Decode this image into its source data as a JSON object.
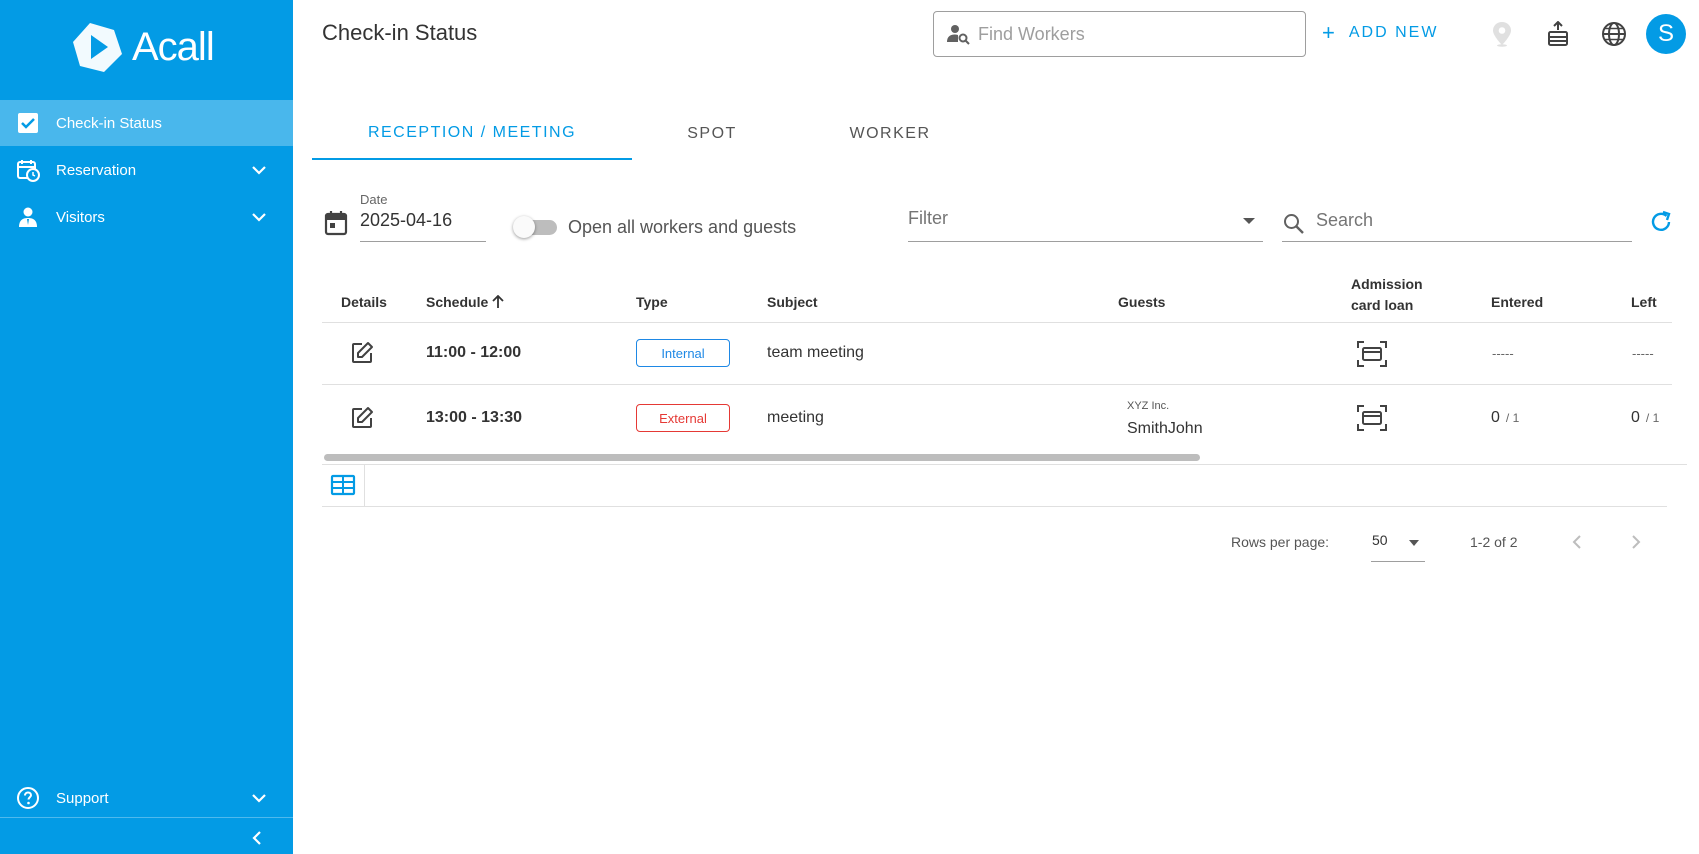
{
  "app": {
    "name": "Acall"
  },
  "sidebar": {
    "items": [
      {
        "label": "Check-in Status",
        "icon": "checkbox-icon",
        "active": true
      },
      {
        "label": "Reservation",
        "icon": "calendar-clock-icon",
        "expandable": true
      },
      {
        "label": "Visitors",
        "icon": "visitor-icon",
        "expandable": true
      }
    ],
    "support": {
      "label": "Support",
      "icon": "help-circle-icon"
    }
  },
  "header": {
    "title": "Check-in Status",
    "find_placeholder": "Find Workers",
    "add_new_label": "ADD NEW",
    "avatar_initial": "S"
  },
  "tabs": [
    {
      "label": "RECEPTION / MEETING",
      "active": true
    },
    {
      "label": "SPOT",
      "active": false
    },
    {
      "label": "WORKER",
      "active": false
    }
  ],
  "controls": {
    "date_label": "Date",
    "date_value": "2025-04-16",
    "toggle_label": "Open all workers and guests",
    "toggle_on": false,
    "filter_placeholder": "Filter",
    "search_placeholder": "Search"
  },
  "table": {
    "columns": {
      "details": "Details",
      "schedule": "Schedule",
      "type": "Type",
      "subject": "Subject",
      "guests": "Guests",
      "admission_line1": "Admission",
      "admission_line2": "card loan",
      "entered": "Entered",
      "left": "Left"
    },
    "rows": [
      {
        "schedule": "11:00 - 12:00",
        "type": "Internal",
        "subject": "team meeting",
        "guest_company": "",
        "guest_name": "",
        "entered": "-----",
        "left": "-----"
      },
      {
        "schedule": "13:00 - 13:30",
        "type": "External",
        "subject": "meeting",
        "guest_company": "XYZ Inc.",
        "guest_name": "SmithJohn",
        "entered_count": "0",
        "entered_total": "/ 1",
        "left_count": "0",
        "left_total": "/ 1"
      }
    ]
  },
  "pagination": {
    "rows_per_page_label": "Rows per page:",
    "rows_per_page_value": "50",
    "range": "1-2 of 2"
  },
  "colors": {
    "primary": "#039be5",
    "internal": "#1e88e5",
    "external": "#e53935"
  }
}
